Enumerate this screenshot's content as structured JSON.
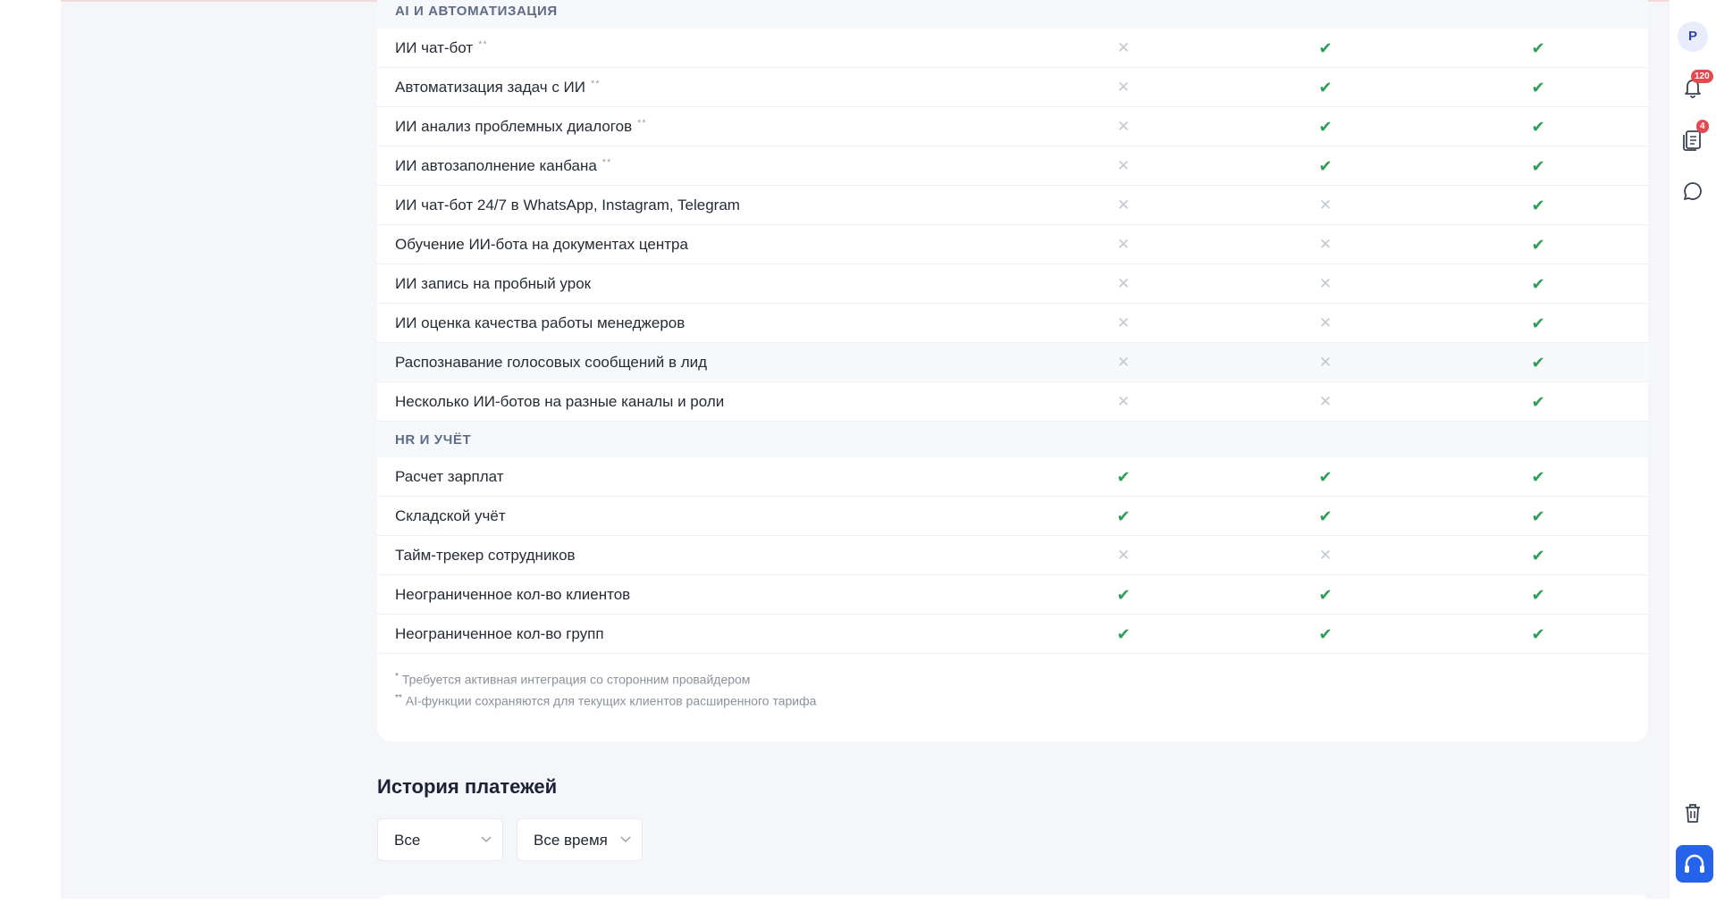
{
  "features": {
    "sections": [
      {
        "title": "AI И АВТОМАТИЗАЦИЯ",
        "rows": [
          {
            "label": "ИИ чат-бот",
            "note": "**",
            "plans": [
              false,
              true,
              true
            ]
          },
          {
            "label": "Автоматизация задач с ИИ",
            "note": "**",
            "plans": [
              false,
              true,
              true
            ]
          },
          {
            "label": "ИИ анализ проблемных диалогов",
            "note": "**",
            "plans": [
              false,
              true,
              true
            ]
          },
          {
            "label": "ИИ автозаполнение канбана",
            "note": "**",
            "plans": [
              false,
              true,
              true
            ]
          },
          {
            "label": "ИИ чат-бот 24/7 в WhatsApp, Instagram, Telegram",
            "note": "",
            "plans": [
              false,
              false,
              true
            ]
          },
          {
            "label": "Обучение ИИ-бота на документах центра",
            "note": "",
            "plans": [
              false,
              false,
              true
            ]
          },
          {
            "label": "ИИ запись на пробный урок",
            "note": "",
            "plans": [
              false,
              false,
              true
            ]
          },
          {
            "label": "ИИ оценка качества работы менеджеров",
            "note": "",
            "plans": [
              false,
              false,
              true
            ]
          },
          {
            "label": "Распознавание голосовых сообщений в лид",
            "note": "",
            "plans": [
              false,
              false,
              true
            ]
          },
          {
            "label": "Несколько ИИ-ботов на разные каналы и роли",
            "note": "",
            "plans": [
              false,
              false,
              true
            ]
          }
        ]
      },
      {
        "title": "HR И УЧЁТ",
        "rows": [
          {
            "label": "Расчет зарплат",
            "note": "",
            "plans": [
              true,
              true,
              true
            ]
          },
          {
            "label": "Складской учёт",
            "note": "",
            "plans": [
              true,
              true,
              true
            ]
          },
          {
            "label": "Тайм-трекер сотрудников",
            "note": "",
            "plans": [
              false,
              false,
              true
            ]
          },
          {
            "label": "Неограниченное кол-во клиентов",
            "note": "",
            "plans": [
              true,
              true,
              true
            ]
          },
          {
            "label": "Неограниченное кол-во групп",
            "note": "",
            "plans": [
              true,
              true,
              true
            ]
          }
        ]
      }
    ],
    "footnotes": [
      {
        "mark": "*",
        "text": "Требуется активная интеграция со сторонним провайдером"
      },
      {
        "mark": "**",
        "text": "AI-функции сохраняются для текущих клиентов расширенного тарифа"
      }
    ]
  },
  "payment_history": {
    "title": "История платежей",
    "filter_type": "Все",
    "filter_period": "Все время"
  },
  "sidebar_right": {
    "avatar_letter": "P",
    "notifications_count": "120",
    "tasks_count": "4"
  },
  "colors": {
    "check": "#2f9e55",
    "cross": "#c3c8d0",
    "accent": "#2563eb",
    "badge": "#e5484d"
  }
}
